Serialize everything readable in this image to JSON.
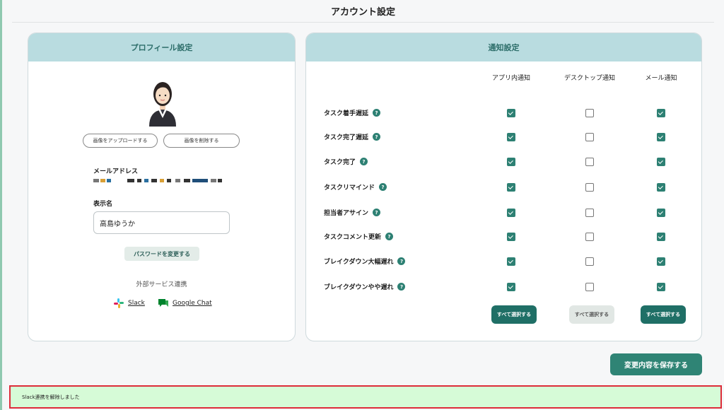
{
  "page": {
    "title": "アカウント設定"
  },
  "profile": {
    "header": "プロフィール設定",
    "upload_label": "画像をアップロードする",
    "delete_label": "画像を削除する",
    "email_label": "メールアドレス",
    "display_name_label": "表示名",
    "display_name_value": "高島ゆうか",
    "change_password_label": "パスワードを変更する",
    "external_title": "外部サービス連携",
    "slack_label": "Slack",
    "google_chat_label": "Google Chat"
  },
  "notifications": {
    "header": "通知設定",
    "columns": [
      "アプリ内通知",
      "デスクトップ通知",
      "メール通知"
    ],
    "rows": [
      {
        "label": "タスク着手遅延",
        "app": true,
        "desktop": false,
        "mail": true
      },
      {
        "label": "タスク完了遅延",
        "app": true,
        "desktop": false,
        "mail": true
      },
      {
        "label": "タスク完了",
        "app": true,
        "desktop": false,
        "mail": true
      },
      {
        "label": "タスクリマインド",
        "app": true,
        "desktop": false,
        "mail": true
      },
      {
        "label": "担当者アサイン",
        "app": true,
        "desktop": false,
        "mail": true
      },
      {
        "label": "タスクコメント更新",
        "app": true,
        "desktop": false,
        "mail": true
      },
      {
        "label": "ブレイクダウン大幅遅れ",
        "app": true,
        "desktop": false,
        "mail": true
      },
      {
        "label": "ブレイクダウンやや遅れ",
        "app": true,
        "desktop": false,
        "mail": true
      }
    ],
    "help_glyph": "?",
    "select_all_label": "すべて選択する"
  },
  "save_label": "変更内容を保存する",
  "toast_message": "Slack連携を解除しました",
  "colors": {
    "accent": "#2f8475",
    "header_bg": "#b9dce0",
    "toast_bg": "#d6fbd7",
    "toast_border": "#dd2c3a"
  }
}
